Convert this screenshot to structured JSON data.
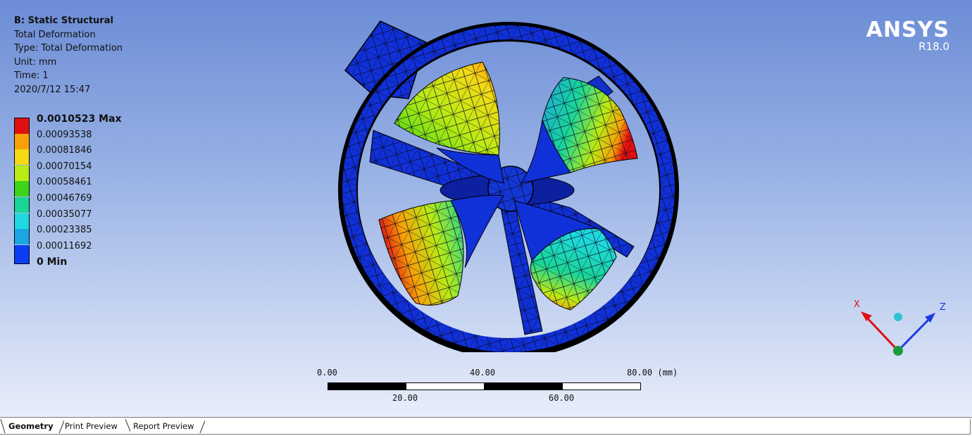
{
  "info": {
    "system": "B: Static Structural",
    "result": "Total Deformation",
    "type": "Type: Total Deformation",
    "unit": "Unit: mm",
    "time": "Time: 1",
    "datetime": "2020/7/12 15:47"
  },
  "legend": [
    {
      "label": "0.0010523 Max",
      "color": "#e01010",
      "bold": true
    },
    {
      "label": "0.00093538",
      "color": "#f7a007"
    },
    {
      "label": "0.00081846",
      "color": "#f4d915"
    },
    {
      "label": "0.00070154",
      "color": "#b9eb14"
    },
    {
      "label": "0.00058461",
      "color": "#3dd319"
    },
    {
      "label": "0.00046769",
      "color": "#1ad598"
    },
    {
      "label": "0.00035077",
      "color": "#1fd8e0"
    },
    {
      "label": "0.00023385",
      "color": "#1aa6e0"
    },
    {
      "label": "0.00011692",
      "color": "#0a3ef5"
    },
    {
      "label": "0 Min",
      "color": "#0a3ef5",
      "bold": true
    }
  ],
  "brand": {
    "name": "ANSYS",
    "version": "R18.0"
  },
  "scalebar": {
    "top_labels": [
      "0.00",
      "40.00",
      "80.00 (mm)"
    ],
    "bottom_labels": [
      "20.00",
      "60.00"
    ]
  },
  "triad": {
    "x_label": "X",
    "z_label": "Z",
    "x_color": "#e01010",
    "z_color": "#1a3ae0",
    "y_color": "#1a9a3a",
    "iso_color": "#2ec4d4"
  },
  "tabs": [
    {
      "label": "Geometry",
      "active": true
    },
    {
      "label": "Print Preview",
      "active": false
    },
    {
      "label": "Report Preview",
      "active": false
    }
  ]
}
